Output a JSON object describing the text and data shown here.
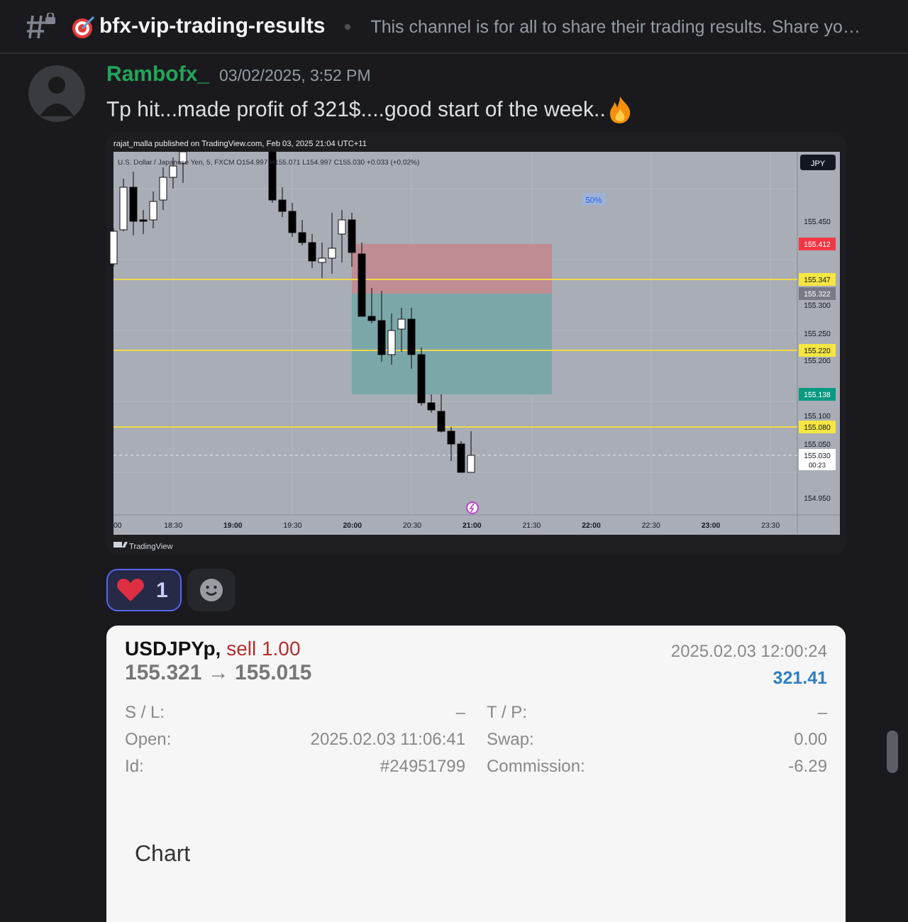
{
  "channel": {
    "name": "bfx-vip-trading-results",
    "topic": "This channel is for all to share their trading results. Share yo…"
  },
  "message": {
    "author": "Rambofx_",
    "timestamp": "03/02/2025, 3:52 PM",
    "text": "Tp hit...made profit of 321$....good start of the week..",
    "screenshot": {
      "source_line": "rajat_malla published on TradingView.com, Feb 03, 2025 21:04 UTC+11",
      "symbol_line": "U.S. Dollar / Japanese Yen, 5, FXCM  O154.997  H155.071  L154.997  C155.030  +0.033 (+0.02%)",
      "currency_button": "JPY",
      "range_label": "50%",
      "price_labels": [
        {
          "text": "155.450",
          "kind": "axis"
        },
        {
          "text": "155.412",
          "kind": "stop"
        },
        {
          "text": "155.347",
          "kind": "line"
        },
        {
          "text": "155.322",
          "kind": "entry"
        },
        {
          "text": "155.300",
          "kind": "axis"
        },
        {
          "text": "155.250",
          "kind": "axis"
        },
        {
          "text": "155.220",
          "kind": "line"
        },
        {
          "text": "155.200",
          "kind": "axis"
        },
        {
          "text": "155.138",
          "kind": "target"
        },
        {
          "text": "155.100",
          "kind": "axis"
        },
        {
          "text": "155.080",
          "kind": "line"
        },
        {
          "text": "155.050",
          "kind": "axis"
        },
        {
          "text": "155.030",
          "kind": "current"
        },
        {
          "text": "154.950",
          "kind": "axis"
        }
      ],
      "countdown": "00:23",
      "time_labels": [
        {
          "text": "00",
          "bold": false
        },
        {
          "text": "18:30",
          "bold": false
        },
        {
          "text": "19:00",
          "bold": true
        },
        {
          "text": "19:30",
          "bold": false
        },
        {
          "text": "20:00",
          "bold": true
        },
        {
          "text": "20:30",
          "bold": false
        },
        {
          "text": "21:00",
          "bold": true
        },
        {
          "text": "21:30",
          "bold": false
        },
        {
          "text": "22:00",
          "bold": true
        },
        {
          "text": "22:30",
          "bold": false
        },
        {
          "text": "23:00",
          "bold": true
        },
        {
          "text": "23:30",
          "bold": false
        }
      ],
      "brand": "TradingView"
    },
    "reactions": [
      {
        "count": "1",
        "selected": true
      }
    ],
    "trade_card": {
      "symbol": "USDJPYp,",
      "side": "sell 1.00",
      "prices": "155.321 → 155.015",
      "close_time": "2025.02.03 12:00:24",
      "profit": "321.41",
      "fields": [
        {
          "label": "S / L:",
          "value": "–"
        },
        {
          "label": "T / P:",
          "value": "–"
        },
        {
          "label": "Open:",
          "value": "2025.02.03 11:06:41"
        },
        {
          "label": "Swap:",
          "value": "0.00"
        },
        {
          "label": "Id:",
          "value": "#24951799"
        },
        {
          "label": "Commission:",
          "value": "-6.29"
        }
      ],
      "chart_link": "Chart"
    }
  }
}
